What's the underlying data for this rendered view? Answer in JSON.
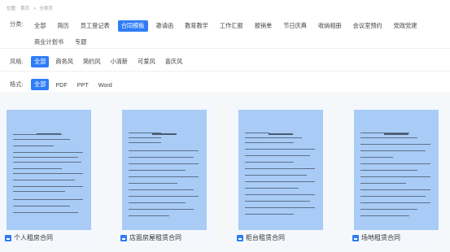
{
  "breadcrumb": {
    "prefix": "位置:",
    "home": "首页",
    "sep": ">",
    "current": "分类页"
  },
  "filters": {
    "category": {
      "label": "分类:",
      "items": [
        "全部",
        "简历",
        "员工登记表",
        "合同模板",
        "邀请函",
        "教育教学",
        "工作汇报",
        "报销单",
        "节日庆典",
        "收纳相册",
        "会议室预约",
        "党政党建",
        "商业计划书",
        "专题"
      ],
      "selected": "合同模板"
    },
    "style": {
      "label": "风格:",
      "items": [
        "全部",
        "商务风",
        "简约风",
        "小清新",
        "可爱风",
        "喜庆风"
      ],
      "selected": "全部"
    },
    "format": {
      "label": "格式:",
      "items": [
        "全部",
        "PDF",
        "PPT",
        "Word"
      ],
      "selected": "全部"
    }
  },
  "cards": [
    {
      "title": "个人租房合同",
      "icon": "document-icon"
    },
    {
      "title": "店面房屋租赁合同",
      "icon": "document-icon"
    },
    {
      "title": "柜台租赁合同",
      "icon": "document-icon"
    },
    {
      "title": "场地租赁合同",
      "icon": "document-icon"
    }
  ],
  "colors": {
    "accent": "#2f7cf6",
    "thumbnail": "#a9ccf6",
    "card_bg": "#f4f8fd",
    "page_bg": "#f6f7f9"
  }
}
